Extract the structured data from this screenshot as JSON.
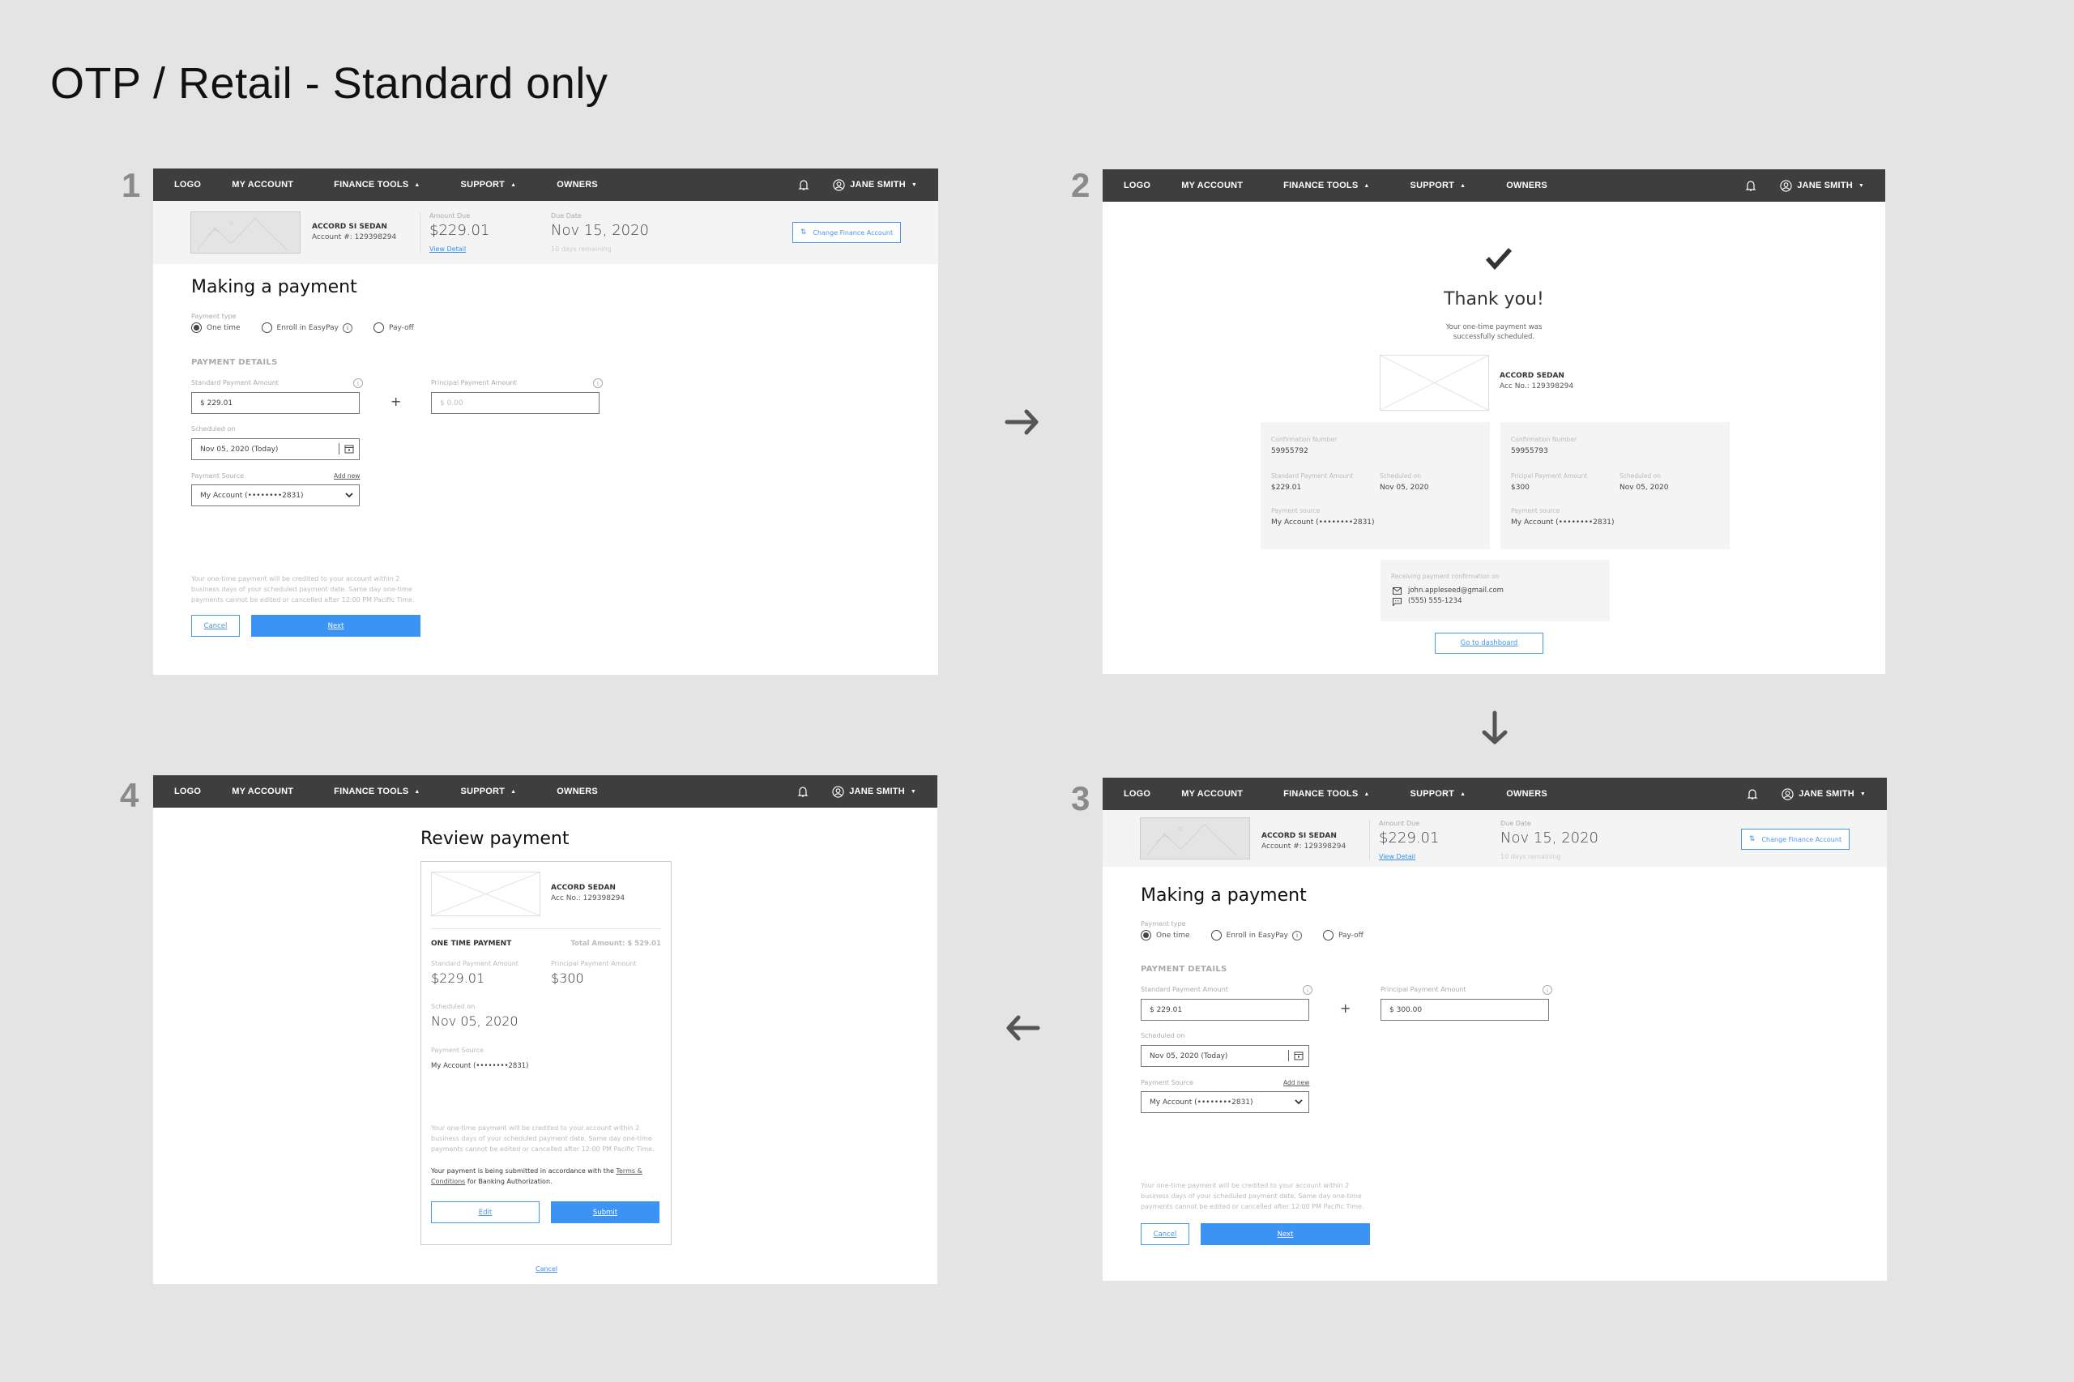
{
  "board": {
    "title": "OTP / Retail - Standard only",
    "step_numbers": [
      "1",
      "2",
      "3",
      "4"
    ],
    "arrows": [
      "right-arrow",
      "down-arrow",
      "left-arrow"
    ]
  },
  "colors": {
    "background": "#e4e4e4",
    "navbar": "#3e3e3e",
    "accent_blue": "#3b93f3",
    "panel_band": "#f4f4f4"
  },
  "nav": {
    "logo": "LOGO",
    "my_account": "MY ACCOUNT",
    "finance_tools": "FINANCE TOOLS",
    "support": "SUPPORT",
    "owners": "OWNERS",
    "user_name": "JANE SMITH",
    "caret_up": "▲",
    "caret_down": "▼"
  },
  "account_band": {
    "vehicle": "ACCORD SI SEDAN",
    "account_number": "Account #: 129398294",
    "amount_due_label": "Amount Due",
    "amount_due": "$229.01",
    "view_detail": "View Detail",
    "due_date_label": "Due Date",
    "due_date": "Nov 15, 2020",
    "days_remaining": "10 days remaining",
    "change_account_button": "Change Finance Account"
  },
  "payment_form": {
    "title": "Making a payment",
    "payment_type_label": "Payment type",
    "payment_types": [
      "One time",
      "Enroll in EasyPay",
      "Pay-off"
    ],
    "selected_payment_type": "One time",
    "section_heading": "PAYMENT DETAILS",
    "standard_amount_label": "Standard Payment Amount",
    "principal_amount_label": "Principal Payment Amount",
    "plus": "+",
    "scheduled_on_label": "Scheduled on",
    "scheduled_on_value": "Nov 05, 2020 (Today)",
    "payment_source_label": "Payment Source",
    "add_new": "Add new",
    "payment_source_value": "My Account (••••••••2831)",
    "disclaimer": "Your one-time payment will be credited to your account within 2 business days of your scheduled payment date. Same day one-time payments cannot be edited or cancelled after 12:00 PM Pacific Time.",
    "cancel": "Cancel",
    "next": "Next"
  },
  "step1": {
    "standard_amount_value": "$ 229.01",
    "principal_amount_placeholder": "$ 0.00"
  },
  "step3": {
    "standard_amount_value": "$ 229.01",
    "principal_amount_value": "$ 300.00"
  },
  "step2": {
    "title": "Thank you!",
    "message_line1": "Your one-time payment was",
    "message_line2": "successfully scheduled.",
    "vehicle": "ACCORD SEDAN",
    "acc_no": "Acc No.: 129398294",
    "confirmations": [
      {
        "conf_label": "Confirmation Number",
        "conf_value": "59955792",
        "amount_label": "Standard Payment Amount",
        "amount_value": "$229.01",
        "sched_label": "Scheduled on",
        "sched_value": "Nov 05, 2020",
        "source_label": "Payment source",
        "source_value": "My Account (••••••••2831)"
      },
      {
        "conf_label": "Confirmation Number",
        "conf_value": "59955793",
        "amount_label": "Pricipal Payment Amount",
        "amount_value": "$300",
        "sched_label": "Scheduled on",
        "sched_value": "Nov 05, 2020",
        "source_label": "Payment source",
        "source_value": "My Account (••••••••2831)"
      }
    ],
    "receiving_label": "Receiving payment confirmation on",
    "email": "john.appleseed@gmail.com",
    "phone": "(555) 555-1234",
    "dashboard_button": "Go to dashboard"
  },
  "step4": {
    "title": "Review payment",
    "vehicle": "ACCORD SEDAN",
    "acc_no": "Acc No.: 129398294",
    "payment_kind": "ONE TIME PAYMENT",
    "total_amount": "Total Amount: $ 529.01",
    "standard_label": "Standard Payment Amount",
    "standard_value": "$229.01",
    "principal_label": "Principal Payment Amount",
    "principal_value": "$300",
    "scheduled_label": "Scheduled on",
    "scheduled_value": "Nov 05, 2020",
    "source_label": "Payment Source",
    "source_value": "My Account (••••••••2831)",
    "disclaimer": "Your one-time payment will be credited to your account within 2 business days of your scheduled payment date. Same day one-time payments cannot be edited or cancelled after 12:00 PM Pacific Time.",
    "terms_prefix": "Your payment is being submitted in accordance with the ",
    "terms_link": "Terms & Conditions",
    "terms_suffix": " for Banking Authorization.",
    "edit": "Edit",
    "submit": "Submit",
    "cancel": "Cancel"
  }
}
